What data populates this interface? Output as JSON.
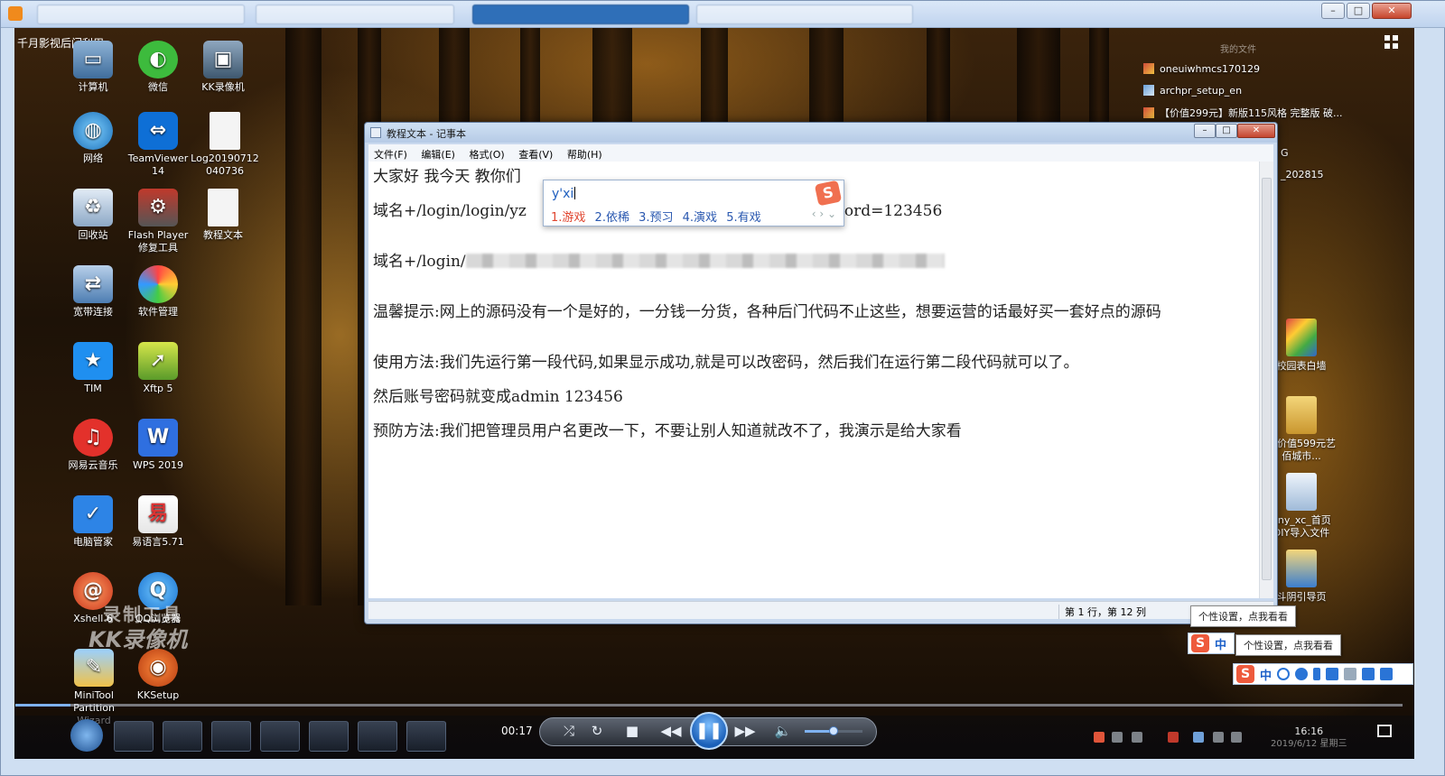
{
  "desktop": {
    "caption": "千月影视后门利用",
    "icons_col1": [
      "计算机",
      "网络",
      "回收站",
      "宽带连接",
      "TIM",
      "网易云音乐",
      "电脑管家",
      "Xshell 6",
      "MiniTool Partition Wizard"
    ],
    "icons_col2": [
      "微信",
      "TeamViewer 14",
      "Flash Player 修复工具",
      "软件管理",
      "Xftp 5",
      "WPS 2019",
      "易语言5.71",
      "QQ浏览器",
      "KKSetup"
    ],
    "icons_col3": [
      "KK录像机",
      "Log20190712040736",
      "教程文本"
    ],
    "right_header": "我的文件",
    "right_items": [
      "oneuiwhmcs170129",
      "archpr_setup_en",
      "【价值299元】新版115风格 完整版 破..."
    ],
    "right_partial": [
      "G",
      "_202815"
    ],
    "right_folders": [
      "校园表白墙",
      "【价值599元艺佰城市...",
      "ony_xc_首页 DIY导入文件",
      "斗阴引导页"
    ],
    "watermark_line1": "录制工具",
    "watermark_line2": "KK录像机"
  },
  "notepad": {
    "title": "教程文本 - 记事本",
    "menu": [
      "文件(F)",
      "编辑(E)",
      "格式(O)",
      "查看(V)",
      "帮助(H)"
    ],
    "lines": {
      "l1": "大家好 我今天 教你们",
      "l2a": "域名+/login/login/yz",
      "l2b": "ssword=123456",
      "l3a": "域名+/login/",
      "l4": "温馨提示:网上的源码没有一个是好的，一分钱一分货，各种后门代码不止这些，想要运营的话最好买一套好点的源码",
      "l5": "使用方法:我们先运行第一段代码,如果显示成功,就是可以改密码，然后我们在运行第二段代码就可以了。",
      "l6": "然后账号密码就变成admin 123456",
      "l7": "预防方法:我们把管理员用户名更改一下，不要让别人知道就改不了，我演示是给大家看"
    },
    "status_position": "第 1 行，第 12 列"
  },
  "ime": {
    "input": "y'xi",
    "logo": "S",
    "candidates": [
      "1.游戏",
      "2.依稀",
      "3.预习",
      "4.演戏",
      "5.有戏"
    ],
    "nav": "‹ › ⌄"
  },
  "tooltips": {
    "tip1": "个性设置，点我看看",
    "tip2": "个性设置，点我看看"
  },
  "sogou": {
    "logo": "S",
    "mode": "中"
  },
  "player": {
    "time": "00:17",
    "progress_fraction": 0.04,
    "volume_fraction": 0.5,
    "clock_time": "16:16",
    "clock_date": "2019/6/12 星期三",
    "buttons": {
      "close": "✕",
      "maximize": "□",
      "minimize": "–"
    }
  },
  "colors": {
    "accent": "#2f6fb8",
    "ime_first_candidate": "#e0452f",
    "ime_candidate": "#2a58b0",
    "sogou": "#ee5a3c"
  }
}
